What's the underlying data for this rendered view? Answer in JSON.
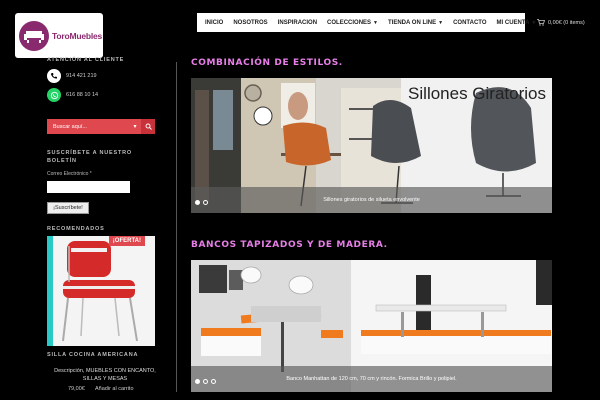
{
  "logo": {
    "text": "ToroMuebles"
  },
  "nav": {
    "items": [
      {
        "label": "INICIO",
        "caret": false
      },
      {
        "label": "NOSOTROS",
        "caret": false
      },
      {
        "label": "INSPIRACION",
        "caret": false
      },
      {
        "label": "COLECCIONES",
        "caret": true
      },
      {
        "label": "TIENDA ON LINE",
        "caret": true
      },
      {
        "label": "CONTACTO",
        "caret": false
      },
      {
        "label": "MI CUENTA",
        "caret": true
      }
    ]
  },
  "cart": {
    "text": "0,00€ (0 items)"
  },
  "sidebar": {
    "contact_title": "ATENCIÓN AL CLIENTE",
    "phone": "914 421 219",
    "whatsapp": "616 88 10 14",
    "search_placeholder": "Buscar aquí...",
    "newsletter_title": "SUSCRÍBETE A NUESTRO BOLETÍN",
    "email_label": "Correo Electrónico *",
    "subscribe_label": "¡Suscríbete!",
    "recommended_title": "RECOMENDADOS",
    "offer_badge": "¡OFERTA!",
    "product_title": "SILLA COCINA AMERICANA",
    "product_name": "Descripción, MUEBLES CON ENCANTO, SILLAS Y MESAS",
    "price": "79,00€",
    "add_to_cart": "Añadir al carrito"
  },
  "main": {
    "section1_title": "COMBINACIÓN DE ESTILOS.",
    "slide1_heading": "Sillones Giratorios",
    "slide1_caption": "Sillones giratorios de silueta envolvente",
    "section2_title": "BANCOS TAPIZADOS Y DE MADERA.",
    "slide2_caption": "Banco Manhattan de 120 cm, 70 cm y rincón. Formica Brillo y polipiel."
  },
  "colors": {
    "accent": "#e0484f",
    "title": "#e87fe8",
    "teal": "#29c9c6",
    "brand": "#8a2a6e"
  }
}
